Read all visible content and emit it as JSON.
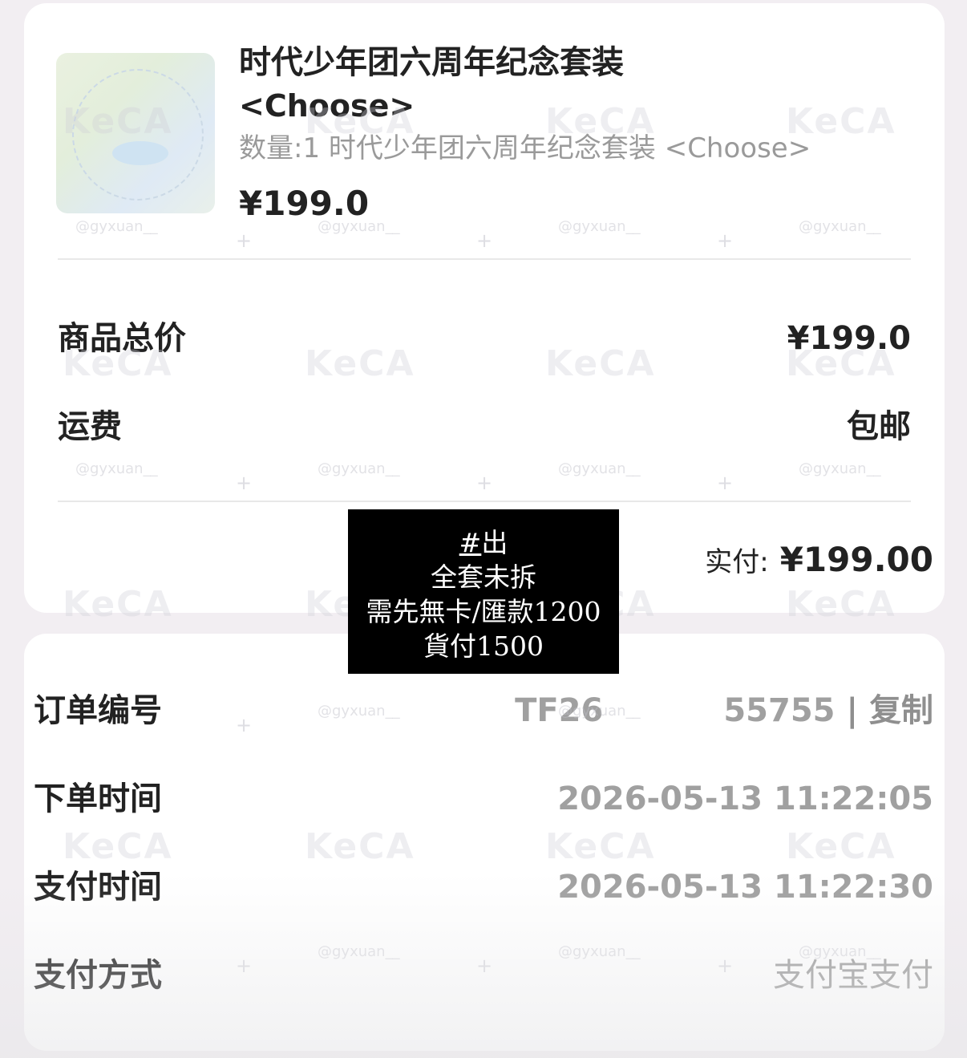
{
  "product": {
    "title": "时代少年团六周年纪念套装",
    "option": "<Choose>",
    "quantity_line": "数量:1 时代少年团六周年纪念套装 <Choose>",
    "price": "¥199.0"
  },
  "summary": {
    "subtotal_label": "商品总价",
    "subtotal_value": "¥199.0",
    "shipping_label": "运费",
    "shipping_value": "包邮",
    "paid_label": "实付:",
    "paid_value": "¥199.00"
  },
  "order_info": {
    "order_no_label": "订单编号",
    "order_no_prefix": "TF26",
    "order_no_suffix": "55755",
    "copy_label": "| 复制",
    "order_time_label": "下单时间",
    "order_time_value": "2026-05-13 11:22:05",
    "pay_time_label": "支付时间",
    "pay_time_value": "2026-05-13 11:22:30",
    "pay_method_label": "支付方式",
    "pay_method_value": "支付宝支付"
  },
  "note_overlay": {
    "line1_hash": "#",
    "line1_text": "出",
    "line2": "全套未拆",
    "line3": "需先無卡/匯款1200",
    "line4": "貨付1500"
  },
  "watermark": {
    "brand": "KeCA",
    "handle": "@gyxuan__"
  }
}
